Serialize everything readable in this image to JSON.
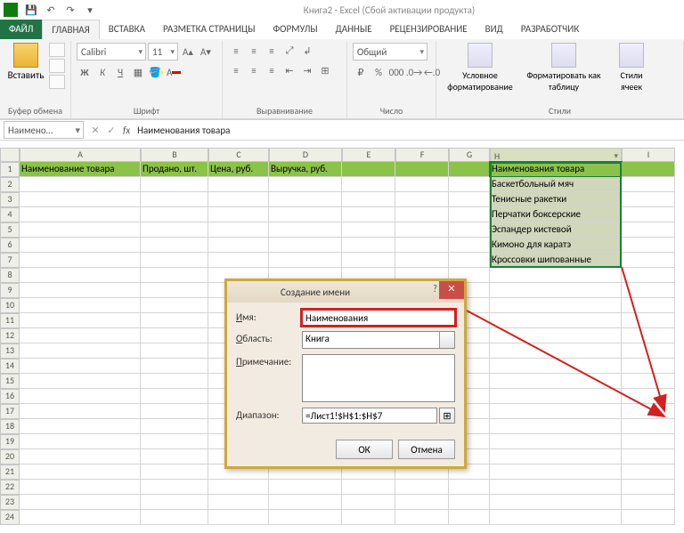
{
  "title": "Книга2 - Excel (Сбой активации продукта)",
  "qat": {
    "save": "💾",
    "undo": "↶",
    "redo": "↷"
  },
  "tabs": {
    "file": "ФАЙЛ",
    "home": "ГЛАВНАЯ",
    "insert": "ВСТАВКА",
    "pagelayout": "РАЗМЕТКА СТРАНИЦЫ",
    "formulas": "ФОРМУЛЫ",
    "data": "ДАННЫЕ",
    "review": "РЕЦЕНЗИРОВАНИЕ",
    "view": "ВИД",
    "developer": "РАЗРАБОТЧИК"
  },
  "ribbon": {
    "paste": "Вставить",
    "clipboard_label": "Буфер обмена",
    "font_name": "Calibri",
    "font_size": "11",
    "font_label": "Шрифт",
    "general": "Общий",
    "alignment_label": "Выравнивание",
    "number_label": "Число",
    "cond_format": "Условное форматирование",
    "format_table": "Форматировать как таблицу",
    "cell_styles": "Стили ячеек",
    "styles_label": "Стили"
  },
  "namebox": "Наимено…",
  "formula_text": "Наименования товара",
  "columns": [
    "A",
    "B",
    "C",
    "D",
    "E",
    "F",
    "G",
    "H",
    "I"
  ],
  "row1": {
    "A": "Наименование товара",
    "B": "Продано, шт.",
    "C": "Цена, руб.",
    "D": "Выручка, руб."
  },
  "h_data": [
    "Наименования товара",
    "Баскетбольный мяч",
    "Тенисные ракетки",
    "Перчатки боксерские",
    "Эспандер кистевой",
    "Кимоно для каратэ",
    "Кроссовки шипованные"
  ],
  "dialog": {
    "title": "Создание имени",
    "name_label": "Имя:",
    "name_value": "Наименования",
    "scope_label": "Область:",
    "scope_value": "Книга",
    "comment_label": "Примечание:",
    "range_label": "Диапазон:",
    "range_value": "=Лист1!$H$1:$H$7",
    "ok": "ОК",
    "cancel": "Отмена"
  }
}
